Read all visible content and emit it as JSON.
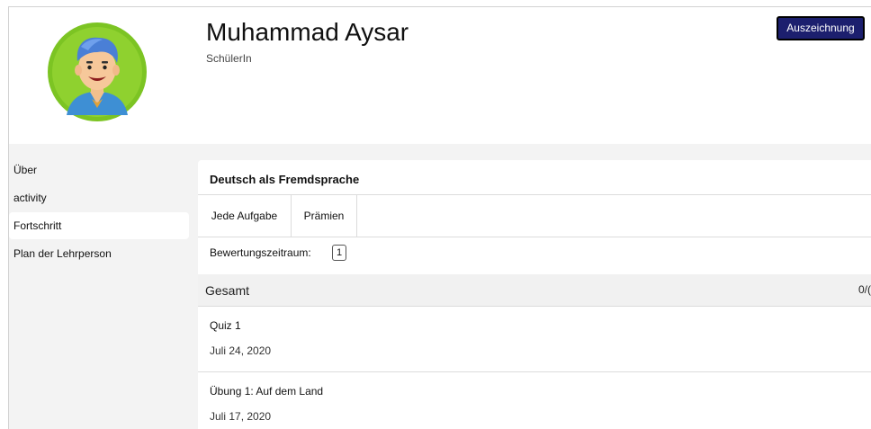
{
  "profile": {
    "name": "Muhammad Aysar",
    "role": "SchülerIn",
    "award_button": "Auszeichnung",
    "avatar_icon": "student-avatar-icon"
  },
  "sidebar": {
    "items": [
      {
        "label": "Über",
        "active": false
      },
      {
        "label": "activity",
        "active": false
      },
      {
        "label": "Fortschritt",
        "active": true
      },
      {
        "label": "Plan der Lehrperson",
        "active": false
      }
    ]
  },
  "course": {
    "title": "Deutsch als Fremdsprache",
    "tabs": [
      "Jede Aufgabe",
      "Prämien"
    ],
    "selected_tab": "Jede Aufgabe",
    "period_label": "Bewertungszeitraum:",
    "period_value": "1"
  },
  "summary": {
    "label": "Gesamt",
    "score": "0/("
  },
  "tasks": [
    {
      "title": "Quiz 1",
      "date": "Juli 24, 2020"
    },
    {
      "title": "Übung 1: Auf dem Land",
      "date": "Juli 17, 2020"
    }
  ],
  "colors": {
    "award_button_bg": "#1c1f6e",
    "panel_bg": "#f3f3f3",
    "avatar_ring": "#7cc423",
    "avatar_hair": "#4a7fd6"
  }
}
